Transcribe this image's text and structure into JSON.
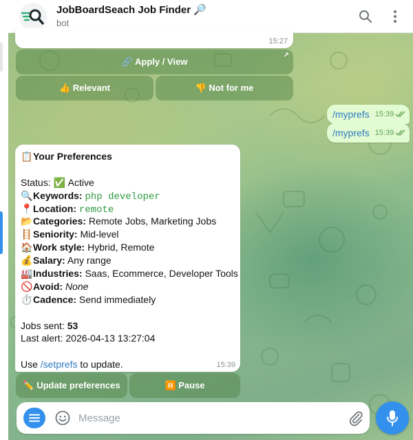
{
  "header": {
    "title": "JobBoardSeach Job Finder 🔎",
    "subtitle": "bot"
  },
  "previous_message": {
    "time": "15:27"
  },
  "job_keyboard": {
    "apply_label": "🔗 Apply / View",
    "relevant_label": "👍 Relevant",
    "not_for_me_label": "👎 Not for me"
  },
  "outgoing": [
    {
      "text": "/myprefs",
      "time": "15:39"
    },
    {
      "text": "/myprefs",
      "time": "15:39"
    }
  ],
  "prefs_message": {
    "heading": "Your Preferences",
    "heading_icon": "📋",
    "status_label": "Status:",
    "status_icon": "✅",
    "status_value": "Active",
    "keywords_icon": "🔍",
    "keywords_label": "Keywords:",
    "keywords_value": "php developer",
    "location_icon": "📍",
    "location_label": "Location:",
    "location_value": "remote",
    "categories_icon": "📂",
    "categories_label": "Categories:",
    "categories_value": "Remote Jobs, Marketing Jobs",
    "seniority_icon": "🪜",
    "seniority_label": "Seniority:",
    "seniority_value": "Mid-level",
    "workstyle_icon": "🏠",
    "workstyle_label": "Work style:",
    "workstyle_value": "Hybrid, Remote",
    "salary_icon": "💰",
    "salary_label": "Salary:",
    "salary_value": "Any range",
    "industries_icon": "🏭",
    "industries_label": "Industries:",
    "industries_value": "Saas, Ecommerce, Developer Tools",
    "avoid_icon": "🚫",
    "avoid_label": "Avoid:",
    "avoid_value": "None",
    "cadence_icon": "⏱️",
    "cadence_label": "Cadence:",
    "cadence_value": "Send immediately",
    "jobs_sent_label": "Jobs sent:",
    "jobs_sent_value": "53",
    "last_alert_label": "Last alert:",
    "last_alert_value": "2026-04-13 13:27:04",
    "use_prefix": "Use",
    "setprefs_link": "/setprefs",
    "use_suffix": "to update.",
    "time": "15:39"
  },
  "prefs_keyboard": {
    "update_label": "✏️ Update preferences",
    "pause_label": "⏸️ Pause"
  },
  "composer": {
    "placeholder": "Message"
  },
  "icons": {
    "search": "search-icon",
    "more": "more-vertical-icon",
    "menu": "menu-icon",
    "emoji": "smile-icon",
    "attach": "paperclip-icon",
    "mic": "microphone-icon",
    "read": "double-check-icon",
    "external": "open-external-icon"
  },
  "colors": {
    "accent": "#3390ec",
    "outgoing_bubble": "#e2fbd2",
    "keyword_mono": "#2e9a3e",
    "link": "#2f7bc0"
  }
}
